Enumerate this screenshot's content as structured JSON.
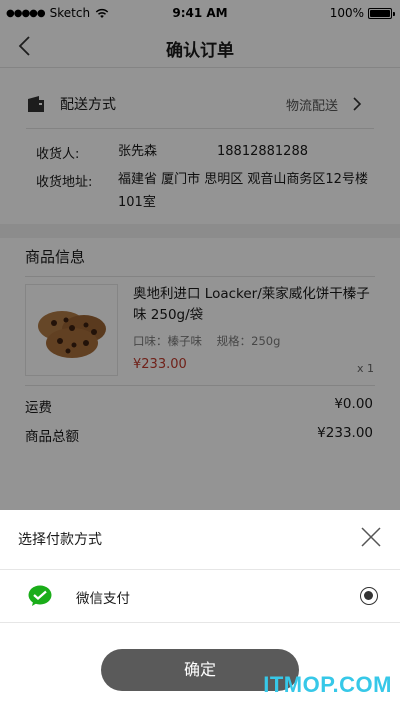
{
  "status_bar": {
    "carrier": "Sketch",
    "time": "9:41 AM",
    "battery": "100%"
  },
  "nav": {
    "title": "确认订单",
    "back_icon": "chevron-left-icon"
  },
  "delivery": {
    "label": "配送方式",
    "value": "物流配送",
    "icon": "truck-card-icon"
  },
  "address": {
    "receiver_label": "收货人:",
    "receiver_name": "张先森",
    "phone": "18812881288",
    "address_label": "收货地址:",
    "address_value": "福建省 厦门市 思明区 观音山商务区12号楼101室"
  },
  "goods": {
    "section_title": "商品信息",
    "product": {
      "name": "奥地利进口 Loacker/莱家威化饼干榛子味 250g/袋",
      "spec": "口味：榛子味    规格：250g",
      "price": "¥233.00",
      "qty": "x 1"
    },
    "fees": [
      {
        "label": "运费",
        "value": "¥0.00"
      },
      {
        "label": "商品总额",
        "value": "¥233.00"
      }
    ]
  },
  "payment_sheet": {
    "title": "选择付款方式",
    "method": "微信支付",
    "method_icon": "wechat-pay-icon",
    "selected": true,
    "confirm": "确定"
  },
  "watermark": "ITMOP.COM",
  "colors": {
    "overlay": "#000000",
    "price": "#c0392b",
    "wechat_green": "#1aad19",
    "button": "#5a5a5a",
    "watermark": "#37c8e8"
  }
}
